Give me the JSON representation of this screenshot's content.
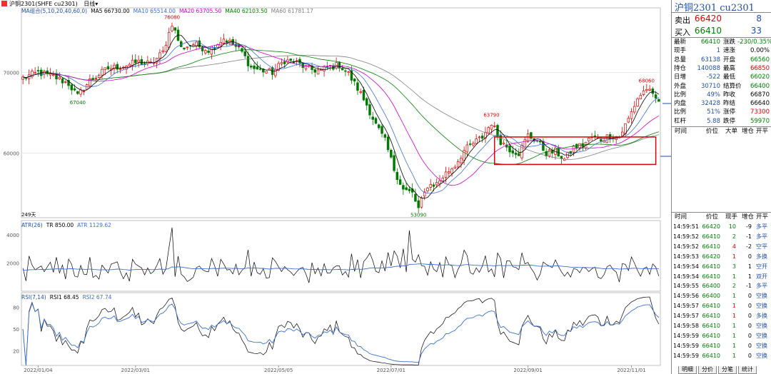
{
  "window": {
    "title": "沪铜2301(SHFE cu2301)",
    "period": "日线",
    "period_arrow": "▾"
  },
  "legends": {
    "ma": [
      {
        "text": "MA组合(5,10,20,40,60,0)",
        "color": "#1f4fa8"
      },
      {
        "text": "MA5 66730.00",
        "color": "#000000"
      },
      {
        "text": "MA10 65514.00",
        "color": "#3b6fd6"
      },
      {
        "text": "MA20 63705.50",
        "color": "#d000d0"
      },
      {
        "text": "MA40 62103.50",
        "color": "#008000"
      },
      {
        "text": "MA60 61781.17",
        "color": "#808080"
      }
    ],
    "atr": [
      {
        "text": "ATR(26)",
        "color": "#1f4fa8"
      },
      {
        "text": "TR 850.00",
        "color": "#000000"
      },
      {
        "text": "ATR 1129.62",
        "color": "#3b6fd6"
      }
    ],
    "rsi": [
      {
        "text": "RSI(7,14)",
        "color": "#1f4fa8"
      },
      {
        "text": "RSI1 68.45",
        "color": "#000000"
      },
      {
        "text": "RSI2 67.74",
        "color": "#3b6fd6"
      }
    ]
  },
  "price_axis": [
    "70000",
    "60000"
  ],
  "atr_axis": [
    "4000",
    "2000"
  ],
  "rsi_axis": [
    "80",
    "50",
    "20"
  ],
  "date_axis": [
    "2022/01/04",
    "2022/03/01",
    "2022/05/05",
    "2022/07/01",
    "2022/09/01",
    "2022/11/01"
  ],
  "annotations": {
    "high1": "76080",
    "low1": "67040",
    "low2": "53090",
    "high2": "63790",
    "high3": "68060",
    "days": "249天"
  },
  "quote_panel": {
    "title": "沪铜2301  cu2301",
    "sell": {
      "label": "卖出",
      "price": "66420",
      "volume": "8"
    },
    "buy": {
      "label": "买入",
      "price": "66410",
      "volume": "33"
    },
    "rows": [
      {
        "l1": "最新",
        "v1": "66410",
        "c1": "green",
        "l2": "涨跌",
        "v2": "-230/0.35%",
        "c2": "green"
      },
      {
        "l1": "现手",
        "v1": "1",
        "c1": "blue",
        "l2": "速涨",
        "v2": "0.00%",
        "c2": "black"
      },
      {
        "l1": "总量",
        "v1": "63138",
        "c1": "blue",
        "l2": "开盘",
        "v2": "66560",
        "c2": "green"
      },
      {
        "l1": "持仓",
        "v1": "140088",
        "c1": "blue",
        "l2": "最高",
        "v2": "66850",
        "c2": "red"
      },
      {
        "l1": "日增",
        "v1": "-522",
        "c1": "blue",
        "l2": "最低",
        "v2": "66020",
        "c2": "green"
      },
      {
        "l1": "外盘",
        "v1": "30710",
        "c1": "blue",
        "l2": "结算价",
        "v2": "66400",
        "c2": "green"
      },
      {
        "l1": "比例",
        "v1": "49%",
        "c1": "blue",
        "l2": "昨收",
        "v2": "66870",
        "c2": "black"
      },
      {
        "l1": "内盘",
        "v1": "32428",
        "c1": "blue",
        "l2": "昨结",
        "v2": "66640",
        "c2": "black"
      },
      {
        "l1": "比例",
        "v1": "51%",
        "c1": "blue",
        "l2": "涨停",
        "v2": "73300",
        "c2": "red"
      },
      {
        "l1": "杠杆",
        "v1": "5.88",
        "c1": "blue",
        "l2": "跌停",
        "v2": "59970",
        "c2": "green"
      }
    ],
    "tick_header": [
      "时间",
      "价位",
      "大单",
      "增仓",
      "开平"
    ],
    "trade_header": [
      "时间",
      "价位",
      "现手",
      "增仓",
      "开平"
    ],
    "trades": [
      {
        "time": "14:59:51",
        "price": "66420",
        "vol": "10",
        "vc": "green",
        "chg": "-9",
        "type": "多平"
      },
      {
        "time": "14:59:52",
        "price": "66410",
        "vol": "2",
        "vc": "green",
        "chg": "-1",
        "type": "多平"
      },
      {
        "time": "14:59:52",
        "price": "66410",
        "vol": "4",
        "vc": "red",
        "chg": "-2",
        "type": "空平"
      },
      {
        "time": "14:59:53",
        "price": "66420",
        "vol": "1",
        "vc": "red",
        "chg": "0",
        "type": "多换"
      },
      {
        "time": "14:59:54",
        "price": "66410",
        "vol": "3",
        "vc": "green",
        "chg": "1",
        "type": "空开"
      },
      {
        "time": "14:59:54",
        "price": "66410",
        "vol": "1",
        "vc": "green",
        "chg": "1",
        "type": "双开"
      },
      {
        "time": "14:59:55",
        "price": "66400",
        "vol": "2",
        "vc": "green",
        "chg": "-1",
        "type": "多平"
      },
      {
        "time": "14:59:56",
        "price": "66400",
        "vol": "1",
        "vc": "green",
        "chg": "0",
        "type": "空换"
      },
      {
        "time": "14:59:57",
        "price": "66410",
        "vol": "1",
        "vc": "red",
        "chg": "0",
        "type": "空换"
      },
      {
        "time": "14:59:57",
        "price": "66410",
        "vol": "1",
        "vc": "red",
        "chg": "0",
        "type": "多换"
      },
      {
        "time": "14:59:58",
        "price": "66410",
        "vol": "1",
        "vc": "green",
        "chg": "0",
        "type": "空换"
      },
      {
        "time": "14:59:59",
        "price": "66410",
        "vol": "1",
        "vc": "green",
        "chg": "0",
        "type": "空换"
      },
      {
        "time": "14:59:59",
        "price": "66410",
        "vol": "1",
        "vc": "green",
        "chg": "0",
        "type": "空换"
      },
      {
        "time": "14:59:59",
        "price": "66410",
        "vol": "1",
        "vc": "green",
        "chg": "0",
        "type": "空换"
      }
    ],
    "tabs": [
      "明细",
      "分价",
      "分笔",
      "统计"
    ]
  },
  "chart_data": {
    "type": "candlestick",
    "anchors": [
      [
        0,
        69300
      ],
      [
        5,
        70000
      ],
      [
        10,
        69500
      ],
      [
        15,
        68600
      ],
      [
        18,
        67040
      ],
      [
        22,
        69000
      ],
      [
        28,
        70500
      ],
      [
        33,
        70800
      ],
      [
        38,
        71300
      ],
      [
        42,
        71000
      ],
      [
        46,
        72500
      ],
      [
        49,
        76080
      ],
      [
        52,
        73000
      ],
      [
        56,
        73500
      ],
      [
        61,
        72800
      ],
      [
        66,
        74200
      ],
      [
        69,
        73500
      ],
      [
        72,
        72500
      ],
      [
        75,
        70600
      ],
      [
        78,
        70300
      ],
      [
        82,
        70000
      ],
      [
        86,
        71500
      ],
      [
        90,
        71200
      ],
      [
        94,
        70400
      ],
      [
        98,
        70200
      ],
      [
        101,
        70700
      ],
      [
        104,
        70900
      ],
      [
        107,
        69800
      ],
      [
        110,
        68000
      ],
      [
        113,
        66000
      ],
      [
        116,
        63500
      ],
      [
        119,
        61500
      ],
      [
        122,
        58000
      ],
      [
        125,
        55500
      ],
      [
        128,
        55000
      ],
      [
        130,
        53090
      ],
      [
        133,
        56000
      ],
      [
        136,
        56200
      ],
      [
        139,
        57500
      ],
      [
        142,
        58500
      ],
      [
        145,
        60300
      ],
      [
        148,
        61200
      ],
      [
        151,
        62000
      ],
      [
        154,
        63790
      ],
      [
        157,
        61500
      ],
      [
        160,
        60500
      ],
      [
        163,
        60000
      ],
      [
        166,
        62200
      ],
      [
        169,
        61500
      ],
      [
        172,
        60000
      ],
      [
        175,
        60200
      ],
      [
        178,
        59200
      ],
      [
        181,
        60700
      ],
      [
        184,
        61000
      ],
      [
        187,
        62000
      ],
      [
        190,
        61700
      ],
      [
        193,
        62200
      ],
      [
        196,
        62000
      ],
      [
        199,
        64200
      ],
      [
        202,
        66800
      ],
      [
        205,
        68060
      ],
      [
        207,
        67000
      ],
      [
        209,
        66410
      ]
    ],
    "ylim": [
      52000,
      78000
    ],
    "box": {
      "x": [
        155,
        208
      ],
      "y": [
        58600,
        62000
      ]
    }
  }
}
